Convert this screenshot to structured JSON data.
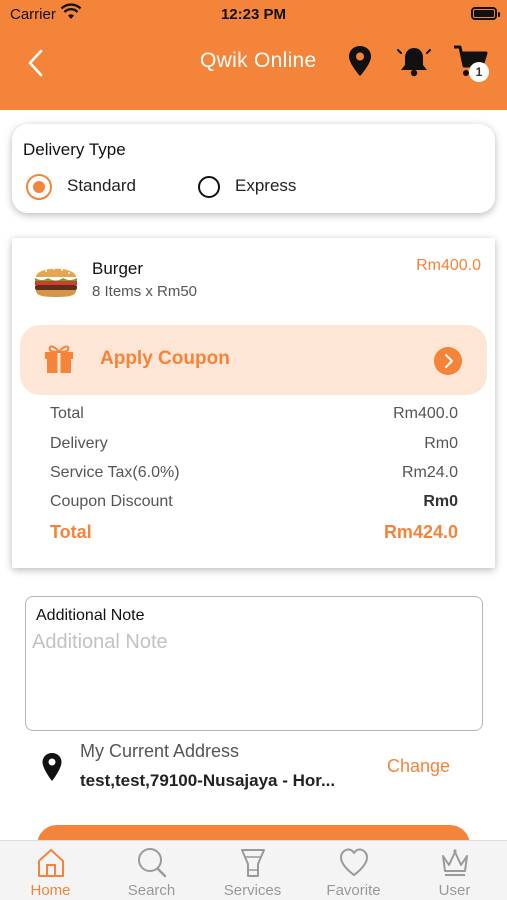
{
  "status": {
    "carrier": "Carrier",
    "time": "12:23 PM"
  },
  "header": {
    "title": "Qwik Online",
    "cart_count": "1",
    "accent_color": "#f3843a",
    "icons": [
      "back-arrow-icon",
      "location-pin-icon",
      "bell-icon",
      "cart-icon"
    ]
  },
  "delivery": {
    "title": "Delivery Type",
    "options": [
      {
        "label": "Standard",
        "selected": true
      },
      {
        "label": "Express",
        "selected": false
      }
    ]
  },
  "order": {
    "item": {
      "name": "Burger",
      "detail": "8 Items x Rm50",
      "price": "Rm400.0"
    },
    "coupon_label": "Apply Coupon",
    "summary": [
      {
        "label": "Total",
        "value": "Rm400.0"
      },
      {
        "label": "Delivery",
        "value": "Rm0"
      },
      {
        "label": "Service Tax(6.0%)",
        "value": "Rm24.0"
      },
      {
        "label": "Coupon Discount",
        "value": "Rm0"
      }
    ],
    "grand_total": {
      "label": "Total",
      "value": "Rm424.0"
    }
  },
  "note": {
    "label": "Additional Note",
    "placeholder": "Additional Note",
    "value": ""
  },
  "address": {
    "title": "My Current Address",
    "text": "test,test,79100-Nusajaya - Hor...",
    "change_label": "Change"
  },
  "tabs": [
    {
      "label": "Home",
      "icon": "home-icon",
      "active": true
    },
    {
      "label": "Search",
      "icon": "search-icon",
      "active": false
    },
    {
      "label": "Services",
      "icon": "services-icon",
      "active": false
    },
    {
      "label": "Favorite",
      "icon": "heart-icon",
      "active": false
    },
    {
      "label": "User",
      "icon": "crown-icon",
      "active": false
    }
  ]
}
